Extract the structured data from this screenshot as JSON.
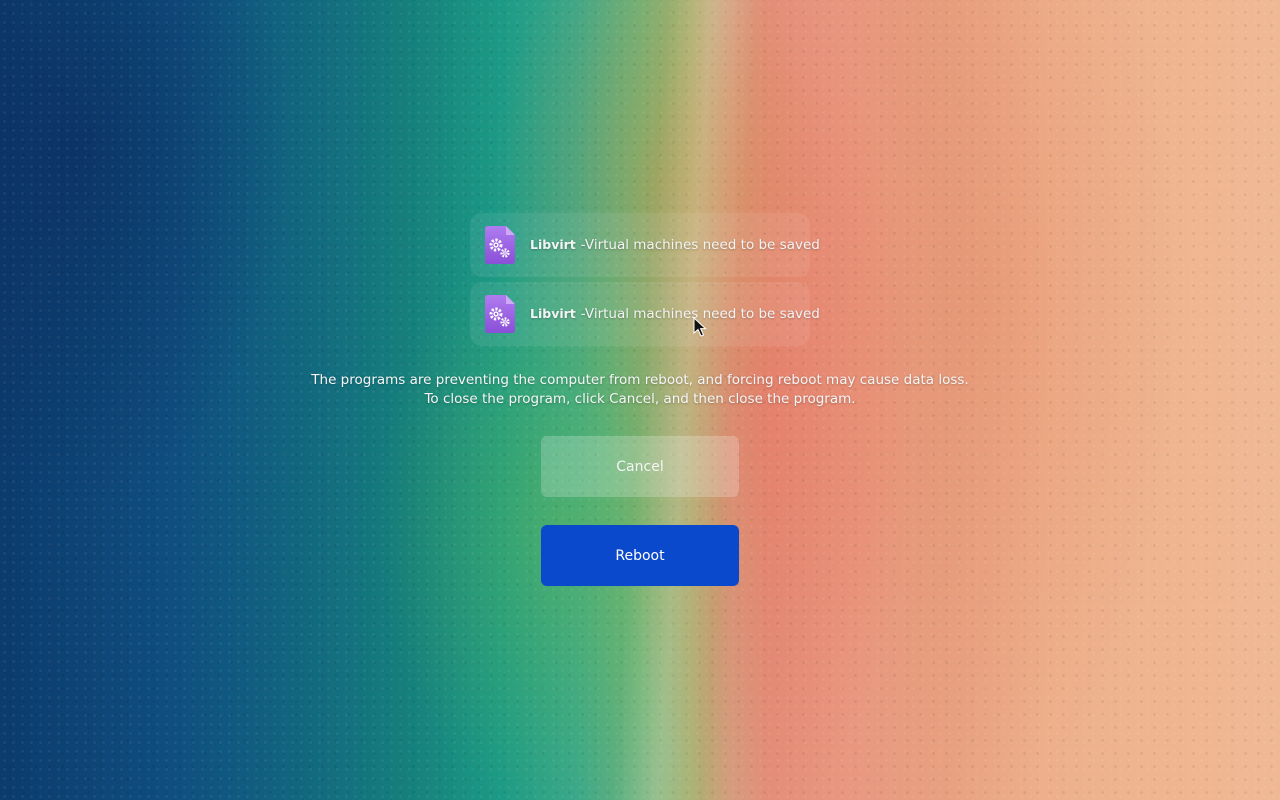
{
  "dialog": {
    "programs": [
      {
        "icon": "gears-app-icon",
        "name": "Libvirt",
        "separator": "-",
        "reason": "Virtual machines need to be saved"
      },
      {
        "icon": "gears-app-icon",
        "name": "Libvirt",
        "separator": "-",
        "reason": "Virtual machines need to be saved"
      }
    ],
    "message_line1": "The programs are preventing the computer from reboot, and forcing reboot may cause data loss.",
    "message_line2": "To close the program, click Cancel, and then close the program.",
    "cancel_label": "Cancel",
    "reboot_label": "Reboot"
  },
  "colors": {
    "reboot_button": "#0a48cc",
    "icon_purple": "#9b5de5"
  }
}
